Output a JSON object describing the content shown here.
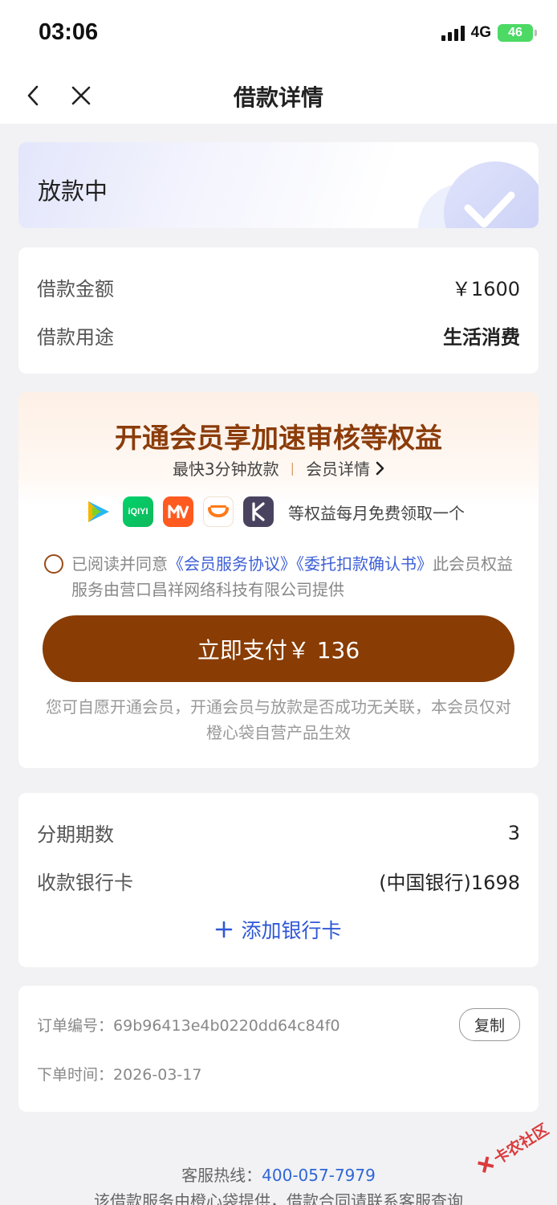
{
  "status_bar": {
    "time": "03:06",
    "network": "4G",
    "battery": "46"
  },
  "nav": {
    "title": "借款详情"
  },
  "status": {
    "text": "放款中"
  },
  "loan": {
    "amount_label": "借款金额",
    "amount_value": "￥1600",
    "purpose_label": "借款用途",
    "purpose_value": "生活消费"
  },
  "member": {
    "title": "开通会员享加速审核等权益",
    "speed": "最快3分钟放款",
    "detail": "会员详情",
    "icons": [
      "tencent-video-icon",
      "iqiyi-icon",
      "mango-tv-icon",
      "didi-icon",
      "keep-icon"
    ],
    "benefit_text": "等权益每月免费领取一个",
    "agree_prefix": "已阅读并同意",
    "link1": "《会员服务协议》",
    "link2": "《委托扣款确认书》",
    "agree_suffix": "此会员权益服务由营口昌祥网络科技有限公司提供",
    "pay_button": "立即支付￥ 136",
    "disclaimer": "您可自愿开通会员，开通会员与放款是否成功无关联，本会员仅对橙心袋自营产品生效"
  },
  "installment": {
    "period_label": "分期期数",
    "period_value": "3",
    "card_label": "收款银行卡",
    "card_value": "(中国银行)1698",
    "add_card": "添加银行卡"
  },
  "order": {
    "no_label": "订单编号：",
    "no_value": "69b96413e4b0220dd64c84f0",
    "copy": "复制",
    "time_label": "下单时间：",
    "time_value": "2026-03-17"
  },
  "footer": {
    "hotline_label": "客服热线：",
    "hotline": "400-057-7979",
    "line2": "该借款服务由橙心袋提供，借款合同请联系客服查询"
  },
  "watermark": "卡农社区",
  "colors": {
    "accent_brown": "#893c03",
    "link_blue": "#2f57d6",
    "title_brown": "#8b3c0a"
  }
}
